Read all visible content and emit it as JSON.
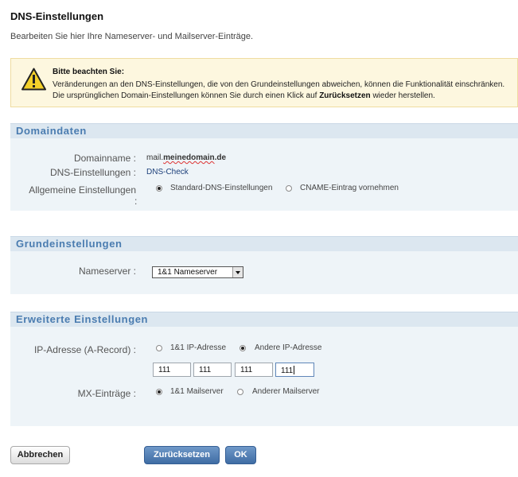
{
  "header": {
    "title": "DNS-Einstellungen",
    "subtitle": "Bearbeiten Sie hier Ihre Nameserver- und Mailserver-Einträge."
  },
  "warning": {
    "icon": "warning-icon",
    "heading": "Bitte beachten Sie:",
    "line1": "Veränderungen an den DNS-Einstellungen, die von den Grundeinstellungen abweichen, können die Funktionalität einschränken.",
    "line2_before": "Die ursprünglichen Domain-Einstellungen können Sie durch einen Klick auf ",
    "line2_bold": "Zurücksetzen",
    "line2_after": " wieder herstellen."
  },
  "domaindaten": {
    "heading": "Domaindaten",
    "domain_label": "Domainname :",
    "domain_prefix": "mail.",
    "domain_name": "meinedomain",
    "domain_suffix": ".de",
    "dns_label": "DNS-Einstellungen :",
    "dns_link": "DNS-Check",
    "general_label_1": "Allgemeine Einstellungen",
    "general_label_2": ":",
    "option_standard": "Standard-DNS-Einstellungen",
    "option_cname": "CNAME-Eintrag vornehmen",
    "selected": "standard"
  },
  "grundeinstellungen": {
    "heading": "Grundeinstellungen",
    "nameserver_label": "Nameserver :",
    "nameserver_value": "1&1 Nameserver"
  },
  "erweitert": {
    "heading": "Erweiterte Einstellungen",
    "ip_label": "IP-Adresse (A-Record) :",
    "ip_option_1and1": "1&1 IP-Adresse",
    "ip_option_other": "Andere IP-Adresse",
    "ip_selected": "other",
    "ip_octets": [
      "111",
      "111",
      "111",
      "111"
    ],
    "mx_label": "MX-Einträge :",
    "mx_option_1and1": "1&1 Mailserver",
    "mx_option_other": "Anderer Mailserver",
    "mx_selected": "1and1"
  },
  "buttons": {
    "cancel": "Abbrechen",
    "reset": "Zurücksetzen",
    "ok": "OK"
  },
  "colors": {
    "section_heading": "#4a7cb0",
    "section_bar": "#dce7f0",
    "panel_bg": "#eef4f8",
    "warning_bg": "#fdf7df",
    "primary_button": "#3f6da4"
  }
}
